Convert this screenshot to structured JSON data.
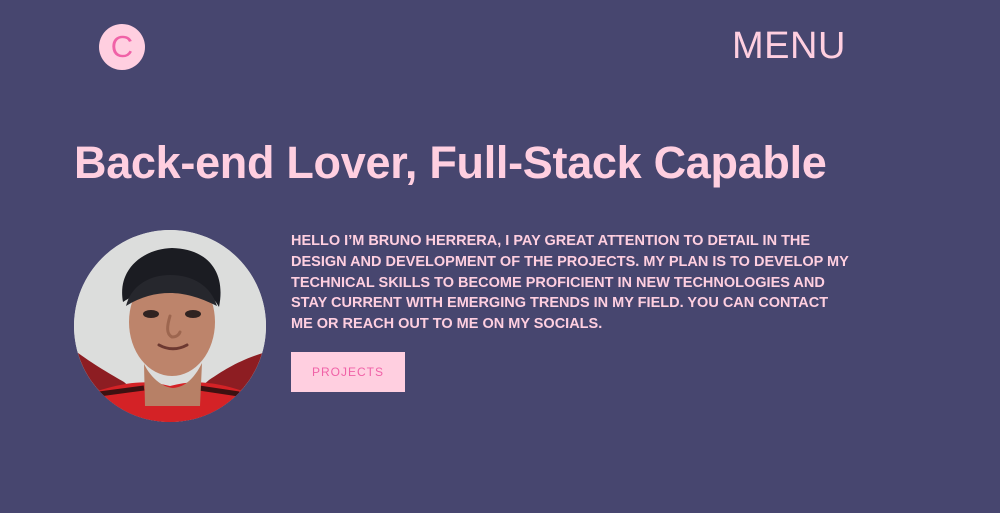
{
  "header": {
    "logo_letter": "C",
    "menu_label": "MENU"
  },
  "hero": {
    "headline": "Back-end Lover, Full-Stack Capable",
    "bio": "HELLO I’M BRUNO HERRERA, I PAY GREAT ATTENTION TO DETAIL IN THE DESIGN AND DEVELOPMENT OF THE PROJECTS. MY PLAN IS TO DEVELOP MY TECHNICAL SKILLS TO BECOME PROFICIENT IN NEW TECHNOLOGIES AND STAY CURRENT WITH EMERGING TRENDS IN MY FIELD. YOU CAN CONTACT ME OR REACH OUT TO ME ON MY SOCIALS.",
    "projects_button_label": "PROJECTS"
  },
  "colors": {
    "background": "#47466f",
    "accent_pink": "#ffcfe0",
    "accent_magenta": "#f062a7"
  },
  "icons": {
    "avatar": "profile-photo"
  }
}
